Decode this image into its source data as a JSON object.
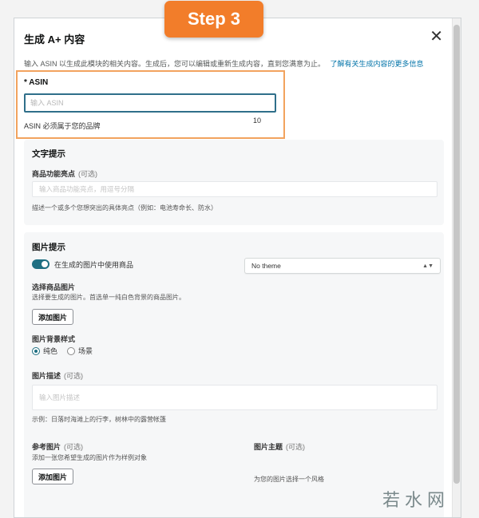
{
  "step_label": "Step 3",
  "modal": {
    "title": "生成 A+ 内容",
    "close": "✕",
    "description": "输入 ASIN 以生成此模块的相关内容。生成后，您可以编辑或重新生成内容，直到您满意为止。",
    "learn_more": "了解有关生成内容的更多信息"
  },
  "asin": {
    "label": "* ASIN",
    "placeholder": "输入 ASIN",
    "hint": "ASIN 必须属于您的品牌",
    "count": "10"
  },
  "text_section": {
    "title": "文字提示",
    "field_label": "商品功能亮点",
    "optional": "(可选)",
    "placeholder": "输入商品功能亮点，用逗号分隔",
    "hint": "描述一个或多个您想突出的具体亮点（例如：电池寿命长、防水）"
  },
  "image_section": {
    "title": "图片提示",
    "toggle_label": "在生成的图片中使用商品",
    "select_label": "选择商品图片",
    "select_hint": "选择要生成的图片。首选单一纯白色背景的商品图片。",
    "add_button": "添加图片",
    "bg_label": "图片背景样式",
    "bg_options": [
      "纯色",
      "场景"
    ],
    "desc_label": "图片描述",
    "desc_optional": "(可选)",
    "desc_placeholder": "输入图片描述",
    "desc_hint": "示例：日落时海滩上的行李，树林中的露营帐篷",
    "ref_label": "参考图片",
    "ref_optional": "(可选)",
    "ref_hint": "添加一张您希望生成的图片作为样例对象",
    "ref_button": "添加图片",
    "theme_label": "图片主题",
    "theme_optional": "(可选)",
    "theme_value": "No theme",
    "theme_hint": "为您的图片选择一个风格"
  },
  "watermark": "若水网"
}
